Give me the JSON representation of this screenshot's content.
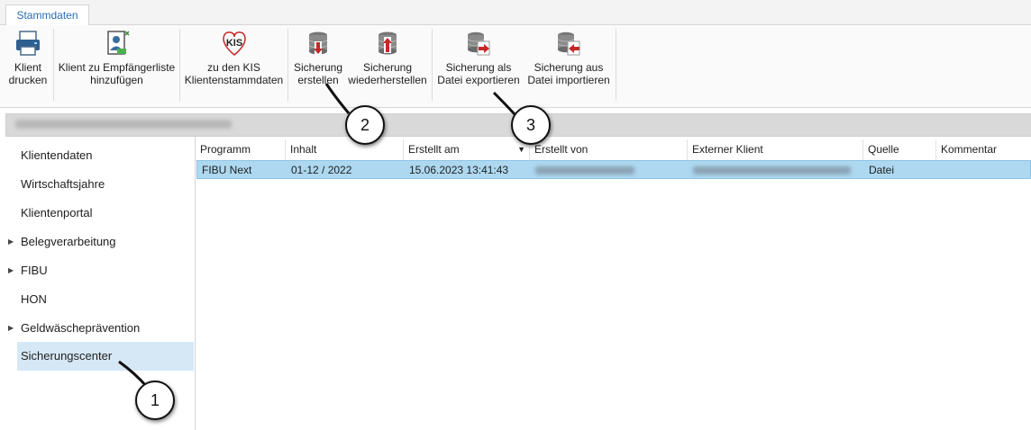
{
  "tabs": [
    {
      "label": "Stammdaten"
    }
  ],
  "ribbon": {
    "client_print": {
      "line1": "Klient",
      "line2": "drucken",
      "icon": "printer-icon"
    },
    "add_recipient": {
      "line1": "Klient zu Empfängerliste",
      "line2": "hinzufügen",
      "icon": "add-user-document-icon"
    },
    "kis": {
      "logo": "KIS",
      "line1": "zu den KIS",
      "line2": "Klientenstammdaten",
      "icon": "kis-logo-icon"
    },
    "backup_create": {
      "line1": "Sicherung",
      "line2": "erstellen",
      "icon": "database-download-icon"
    },
    "backup_restore": {
      "line1": "Sicherung",
      "line2": "wiederherstellen",
      "icon": "database-upload-icon"
    },
    "backup_export": {
      "line1": "Sicherung als",
      "line2": "Datei exportieren",
      "icon": "database-export-icon"
    },
    "backup_import": {
      "line1": "Sicherung aus",
      "line2": "Datei importieren",
      "icon": "database-import-icon"
    }
  },
  "nav": {
    "items": [
      {
        "label": "Klientendaten",
        "expandable": false
      },
      {
        "label": "Wirtschaftsjahre",
        "expandable": false
      },
      {
        "label": "Klientenportal",
        "expandable": false
      },
      {
        "label": "Belegverarbeitung",
        "expandable": true
      },
      {
        "label": "FIBU",
        "expandable": true
      },
      {
        "label": "HON",
        "expandable": false
      },
      {
        "label": "Geldwäscheprävention",
        "expandable": true
      },
      {
        "label": "Sicherungscenter",
        "expandable": false,
        "selected": true
      }
    ]
  },
  "table": {
    "columns": [
      "Programm",
      "Inhalt",
      "Erstellt am",
      "Erstellt von",
      "Externer Klient",
      "Quelle",
      "Kommentar"
    ],
    "sort_column": "Erstellt am",
    "sort_direction": "descending",
    "rows": [
      {
        "programm": "FIBU Next",
        "inhalt": "01-12 / 2022",
        "erstellt_am": "15.06.2023 13:41:43",
        "erstellt_von": "",
        "externer_klient": "",
        "quelle": "Datei",
        "kommentar": ""
      }
    ]
  },
  "callouts": [
    "1",
    "2",
    "3"
  ],
  "colors": {
    "accent": "#2b6cb0",
    "selection": "#add8f0",
    "nav_selected": "#d6e8f6",
    "icon_red": "#c62828"
  }
}
